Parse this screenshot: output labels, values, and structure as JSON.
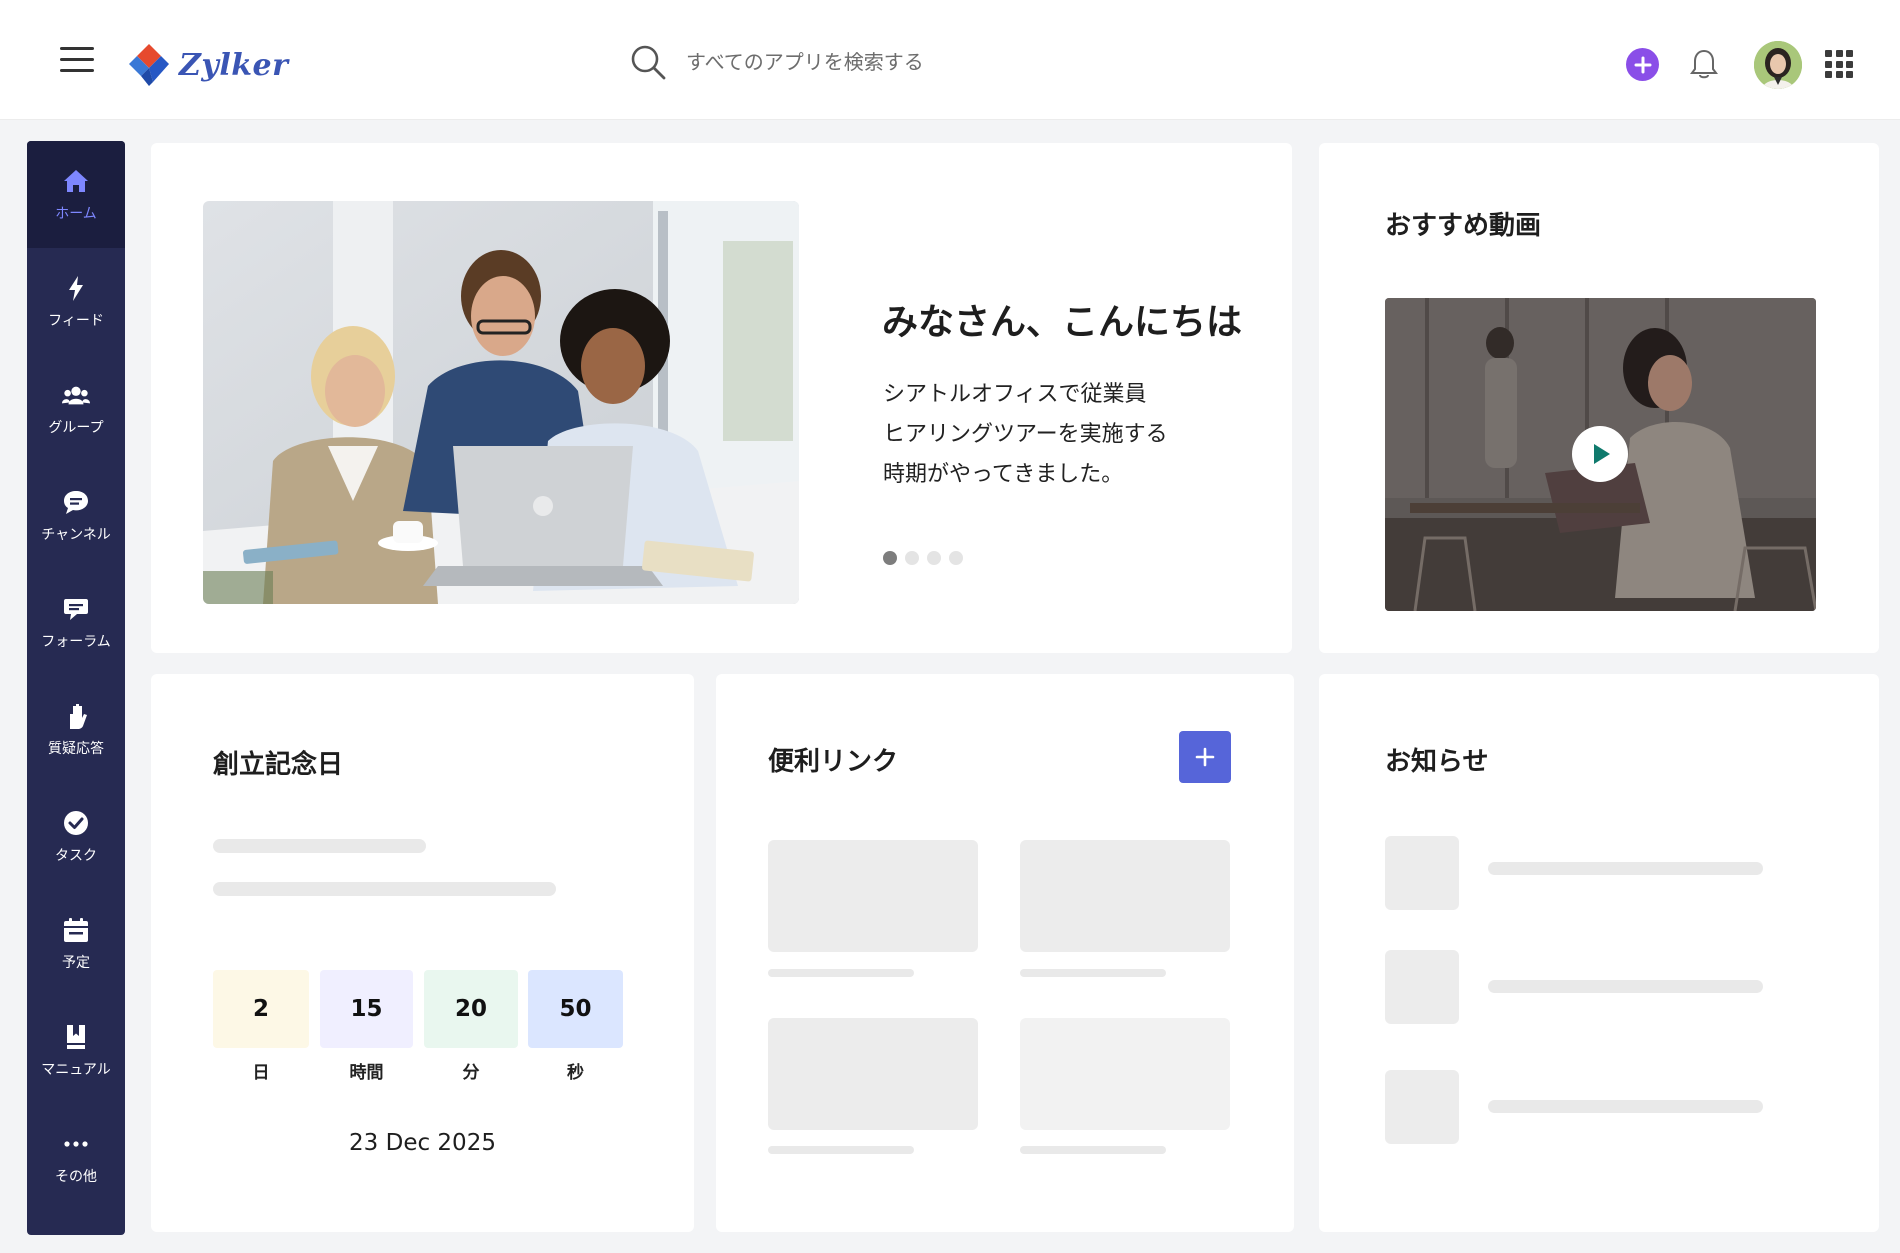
{
  "header": {
    "brand": "Zylker",
    "search_placeholder": "すべてのアプリを検索する"
  },
  "sidebar": {
    "items": [
      {
        "label": "ホーム",
        "icon": "home-icon",
        "active": true
      },
      {
        "label": "フィード",
        "icon": "bolt-icon"
      },
      {
        "label": "グループ",
        "icon": "group-icon"
      },
      {
        "label": "チャンネル",
        "icon": "chat-bubble-icon"
      },
      {
        "label": "フォーラム",
        "icon": "forum-icon"
      },
      {
        "label": "質疑応答",
        "icon": "raised-hand-icon"
      },
      {
        "label": "タスク",
        "icon": "check-circle-icon"
      },
      {
        "label": "予定",
        "icon": "calendar-icon"
      },
      {
        "label": "マニュアル",
        "icon": "book-icon"
      },
      {
        "label": "その他",
        "icon": "more-icon"
      }
    ]
  },
  "hero": {
    "title": "みなさん、こんにちは",
    "body": [
      "シアトルオフィスで従業員",
      "ヒアリングツアーを実施する",
      "時期がやってきました。"
    ],
    "slide_count": 4,
    "active_slide": 0
  },
  "video": {
    "title": "おすすめ動画"
  },
  "anniversary": {
    "title": "創立記念日",
    "countdown": [
      {
        "value": "2",
        "label": "日",
        "color": "#fdf8e6"
      },
      {
        "value": "15",
        "label": "時間",
        "color": "#f0efff"
      },
      {
        "value": "20",
        "label": "分",
        "color": "#e9f7ef"
      },
      {
        "value": "50",
        "label": "秒",
        "color": "#dbe6ff"
      }
    ],
    "date": "23 Dec 2025"
  },
  "links": {
    "title": "便利リンク"
  },
  "notices": {
    "title": "お知らせ"
  },
  "colors": {
    "sidebar_bg": "#262a52",
    "sidebar_active": "#7e87ff",
    "accent_purple": "#8a4ee8",
    "accent_blue": "#5665d9"
  }
}
